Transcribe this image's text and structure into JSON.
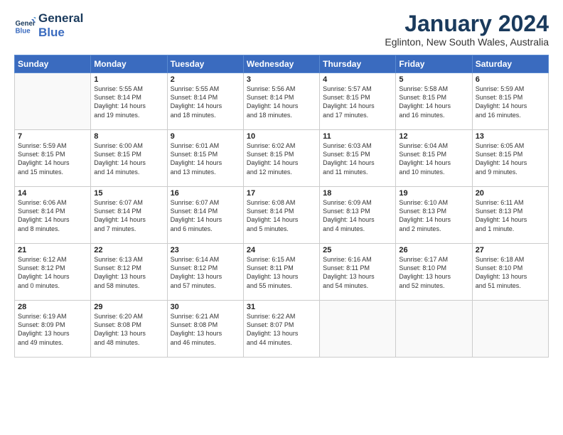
{
  "logo": {
    "line1": "General",
    "line2": "Blue"
  },
  "title": "January 2024",
  "subtitle": "Eglinton, New South Wales, Australia",
  "weekdays": [
    "Sunday",
    "Monday",
    "Tuesday",
    "Wednesday",
    "Thursday",
    "Friday",
    "Saturday"
  ],
  "weeks": [
    [
      {
        "day": "",
        "text": ""
      },
      {
        "day": "1",
        "text": "Sunrise: 5:55 AM\nSunset: 8:14 PM\nDaylight: 14 hours\nand 19 minutes."
      },
      {
        "day": "2",
        "text": "Sunrise: 5:55 AM\nSunset: 8:14 PM\nDaylight: 14 hours\nand 18 minutes."
      },
      {
        "day": "3",
        "text": "Sunrise: 5:56 AM\nSunset: 8:14 PM\nDaylight: 14 hours\nand 18 minutes."
      },
      {
        "day": "4",
        "text": "Sunrise: 5:57 AM\nSunset: 8:15 PM\nDaylight: 14 hours\nand 17 minutes."
      },
      {
        "day": "5",
        "text": "Sunrise: 5:58 AM\nSunset: 8:15 PM\nDaylight: 14 hours\nand 16 minutes."
      },
      {
        "day": "6",
        "text": "Sunrise: 5:59 AM\nSunset: 8:15 PM\nDaylight: 14 hours\nand 16 minutes."
      }
    ],
    [
      {
        "day": "7",
        "text": "Sunrise: 5:59 AM\nSunset: 8:15 PM\nDaylight: 14 hours\nand 15 minutes."
      },
      {
        "day": "8",
        "text": "Sunrise: 6:00 AM\nSunset: 8:15 PM\nDaylight: 14 hours\nand 14 minutes."
      },
      {
        "day": "9",
        "text": "Sunrise: 6:01 AM\nSunset: 8:15 PM\nDaylight: 14 hours\nand 13 minutes."
      },
      {
        "day": "10",
        "text": "Sunrise: 6:02 AM\nSunset: 8:15 PM\nDaylight: 14 hours\nand 12 minutes."
      },
      {
        "day": "11",
        "text": "Sunrise: 6:03 AM\nSunset: 8:15 PM\nDaylight: 14 hours\nand 11 minutes."
      },
      {
        "day": "12",
        "text": "Sunrise: 6:04 AM\nSunset: 8:15 PM\nDaylight: 14 hours\nand 10 minutes."
      },
      {
        "day": "13",
        "text": "Sunrise: 6:05 AM\nSunset: 8:15 PM\nDaylight: 14 hours\nand 9 minutes."
      }
    ],
    [
      {
        "day": "14",
        "text": "Sunrise: 6:06 AM\nSunset: 8:14 PM\nDaylight: 14 hours\nand 8 minutes."
      },
      {
        "day": "15",
        "text": "Sunrise: 6:07 AM\nSunset: 8:14 PM\nDaylight: 14 hours\nand 7 minutes."
      },
      {
        "day": "16",
        "text": "Sunrise: 6:07 AM\nSunset: 8:14 PM\nDaylight: 14 hours\nand 6 minutes."
      },
      {
        "day": "17",
        "text": "Sunrise: 6:08 AM\nSunset: 8:14 PM\nDaylight: 14 hours\nand 5 minutes."
      },
      {
        "day": "18",
        "text": "Sunrise: 6:09 AM\nSunset: 8:13 PM\nDaylight: 14 hours\nand 4 minutes."
      },
      {
        "day": "19",
        "text": "Sunrise: 6:10 AM\nSunset: 8:13 PM\nDaylight: 14 hours\nand 2 minutes."
      },
      {
        "day": "20",
        "text": "Sunrise: 6:11 AM\nSunset: 8:13 PM\nDaylight: 14 hours\nand 1 minute."
      }
    ],
    [
      {
        "day": "21",
        "text": "Sunrise: 6:12 AM\nSunset: 8:12 PM\nDaylight: 14 hours\nand 0 minutes."
      },
      {
        "day": "22",
        "text": "Sunrise: 6:13 AM\nSunset: 8:12 PM\nDaylight: 13 hours\nand 58 minutes."
      },
      {
        "day": "23",
        "text": "Sunrise: 6:14 AM\nSunset: 8:12 PM\nDaylight: 13 hours\nand 57 minutes."
      },
      {
        "day": "24",
        "text": "Sunrise: 6:15 AM\nSunset: 8:11 PM\nDaylight: 13 hours\nand 55 minutes."
      },
      {
        "day": "25",
        "text": "Sunrise: 6:16 AM\nSunset: 8:11 PM\nDaylight: 13 hours\nand 54 minutes."
      },
      {
        "day": "26",
        "text": "Sunrise: 6:17 AM\nSunset: 8:10 PM\nDaylight: 13 hours\nand 52 minutes."
      },
      {
        "day": "27",
        "text": "Sunrise: 6:18 AM\nSunset: 8:10 PM\nDaylight: 13 hours\nand 51 minutes."
      }
    ],
    [
      {
        "day": "28",
        "text": "Sunrise: 6:19 AM\nSunset: 8:09 PM\nDaylight: 13 hours\nand 49 minutes."
      },
      {
        "day": "29",
        "text": "Sunrise: 6:20 AM\nSunset: 8:08 PM\nDaylight: 13 hours\nand 48 minutes."
      },
      {
        "day": "30",
        "text": "Sunrise: 6:21 AM\nSunset: 8:08 PM\nDaylight: 13 hours\nand 46 minutes."
      },
      {
        "day": "31",
        "text": "Sunrise: 6:22 AM\nSunset: 8:07 PM\nDaylight: 13 hours\nand 44 minutes."
      },
      {
        "day": "",
        "text": ""
      },
      {
        "day": "",
        "text": ""
      },
      {
        "day": "",
        "text": ""
      }
    ]
  ]
}
